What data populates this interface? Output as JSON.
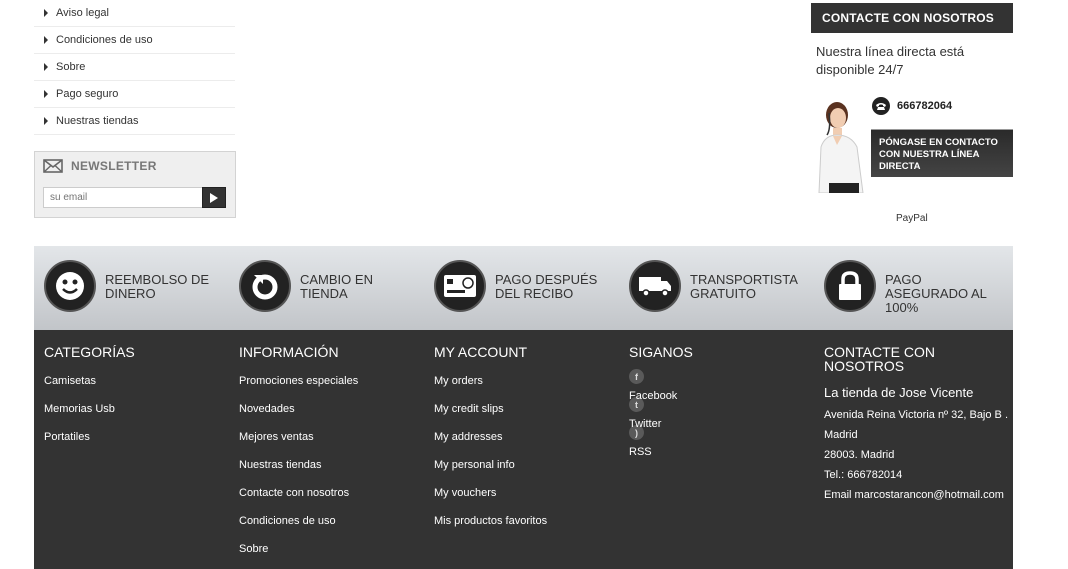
{
  "info_links": [
    "Aviso legal",
    "Condiciones de uso",
    "Sobre",
    "Pago seguro",
    "Nuestras tiendas"
  ],
  "newsletter": {
    "title": "NEWSLETTER",
    "placeholder": "su email"
  },
  "contact": {
    "title": "CONTACTE CON NOSOTROS",
    "text": "Nuestra línea directa está disponible 24/7",
    "phone": "666782064",
    "button": "PÓNGASE EN CONTACTO CON NUESTRA LÍNEA DIRECTA",
    "paypal": "PayPal"
  },
  "reassurance": [
    {
      "label": "REEMBOLSO DE DINERO",
      "icon": "smiley-icon"
    },
    {
      "label": "CAMBIO EN TIENDA",
      "icon": "refresh-icon"
    },
    {
      "label": "PAGO DESPUÉS DEL RECIBO",
      "icon": "credit-card-icon"
    },
    {
      "label": "TRANSPORTISTA GRATUITO",
      "icon": "truck-icon"
    },
    {
      "label": "PAGO ASEGURADO AL 100%",
      "icon": "lock-icon"
    }
  ],
  "footer": {
    "categories": {
      "title": "CATEGORÍAS",
      "items": [
        "Camisetas",
        "Memorias Usb",
        "Portatiles"
      ]
    },
    "info": {
      "title": "INFORMACIÓN",
      "items": [
        "Promociones especiales",
        "Novedades",
        "Mejores ventas",
        "Nuestras tiendas",
        "Contacte con nosotros",
        "Condiciones de uso",
        "Sobre"
      ]
    },
    "account": {
      "title": "MY ACCOUNT",
      "items": [
        "My orders",
        "My credit slips",
        "My addresses",
        "My personal info",
        "My vouchers",
        "Mis productos favoritos"
      ]
    },
    "follow": {
      "title": "SIGANOS",
      "items": [
        {
          "label": "Facebook",
          "icon": "facebook-icon"
        },
        {
          "label": "Twitter",
          "icon": "twitter-icon"
        },
        {
          "label": "RSS",
          "icon": "rss-icon"
        }
      ]
    },
    "contact": {
      "title": "CONTACTE CON NOSOTROS",
      "store": "La tienda de Jose Vicente",
      "lines": [
        "Avenida Reina Victoria nº 32, Bajo B .",
        "Madrid",
        "28003. Madrid",
        "Tel.: 666782014",
        "Email marcostarancon@hotmail.com"
      ]
    }
  },
  "colors": {
    "dark": "#333333",
    "band_top": "#e3e6e9",
    "band_bottom": "#c2c5c9"
  }
}
